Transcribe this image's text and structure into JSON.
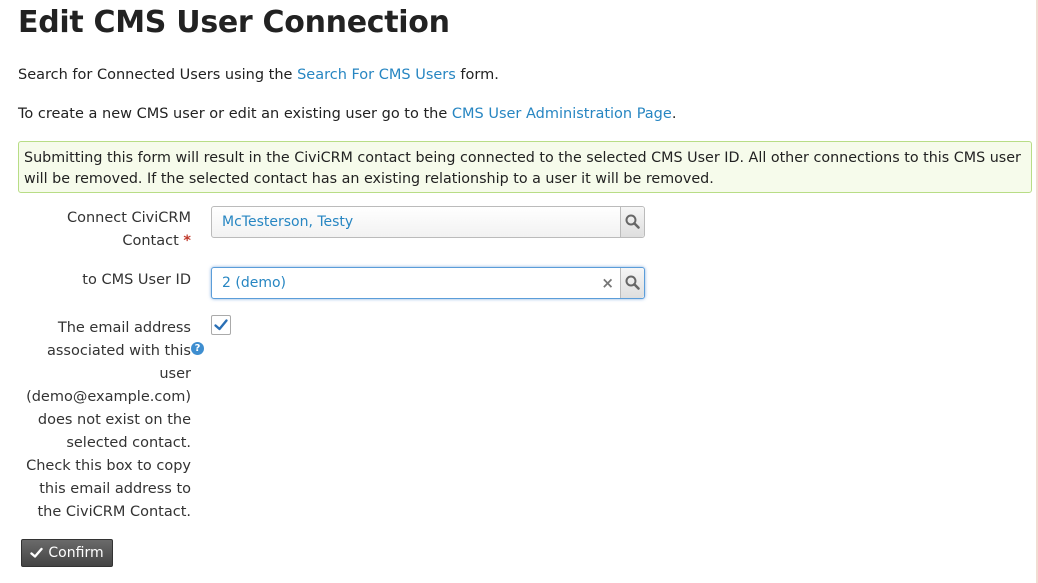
{
  "page": {
    "title": "Edit CMS User Connection",
    "search_line": {
      "before": "Search for Connected Users using the ",
      "link": "Search For CMS Users",
      "after": " form."
    },
    "admin_line": {
      "before": "To create a new CMS user or edit an existing user go to the ",
      "link": "CMS User Administration Page",
      "after": "."
    },
    "notice": "Submitting this form will result in the CiviCRM contact being connected to the selected CMS User ID. All other connections to this CMS user will be removed. If the selected contact has an existing relationship to a user it will be removed."
  },
  "form": {
    "contact_label": "Connect CiviCRM Contact",
    "contact_required_marker": "*",
    "contact_value": "McTesterson, Testy",
    "user_label": "to CMS User ID",
    "user_value": "2 (demo)",
    "clear_symbol": "×",
    "email_label": "The email address associated with this user (demo@example.com) does not exist on the selected contact. Check this box to copy this email address to the CiviCRM Contact.",
    "email_checked": true,
    "help_symbol": "?"
  },
  "actions": {
    "confirm_label": "Confirm"
  },
  "colors": {
    "link": "#2786c2",
    "notice_border": "#b8dd86",
    "notice_bg": "#f6fbeb",
    "required": "#c0392b",
    "button_bg": "#555555"
  },
  "icons": [
    "search-icon",
    "clear-icon",
    "check-icon",
    "help-icon"
  ]
}
